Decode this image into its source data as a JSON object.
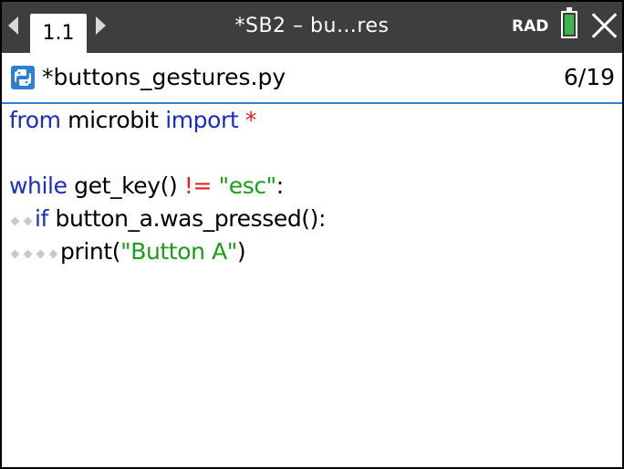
{
  "topbar": {
    "tab_label": "1.1",
    "doc_title": "*SB2 – bu…res",
    "angle_mode": "RAD",
    "battery_color": "#39b54a"
  },
  "editor": {
    "file_name": "*buttons_gestures.py",
    "line_position": "6/19",
    "icon": "python-icon",
    "accent_color": "#2f7fd1"
  },
  "code": {
    "line1": {
      "kw1": "from",
      "t1": " microbit ",
      "kw2": "import",
      "sp": " ",
      "op": "*"
    },
    "line3": {
      "kw": "while",
      "t1": " get_key() ",
      "op": "!=",
      "sp": " ",
      "str": "\"esc\"",
      "t2": ":"
    },
    "line4": {
      "kw": "if",
      "t1": " button_a.was_pressed():"
    },
    "line5": {
      "t1": "print(",
      "str": "\"Button A\"",
      "t2": ")"
    }
  }
}
